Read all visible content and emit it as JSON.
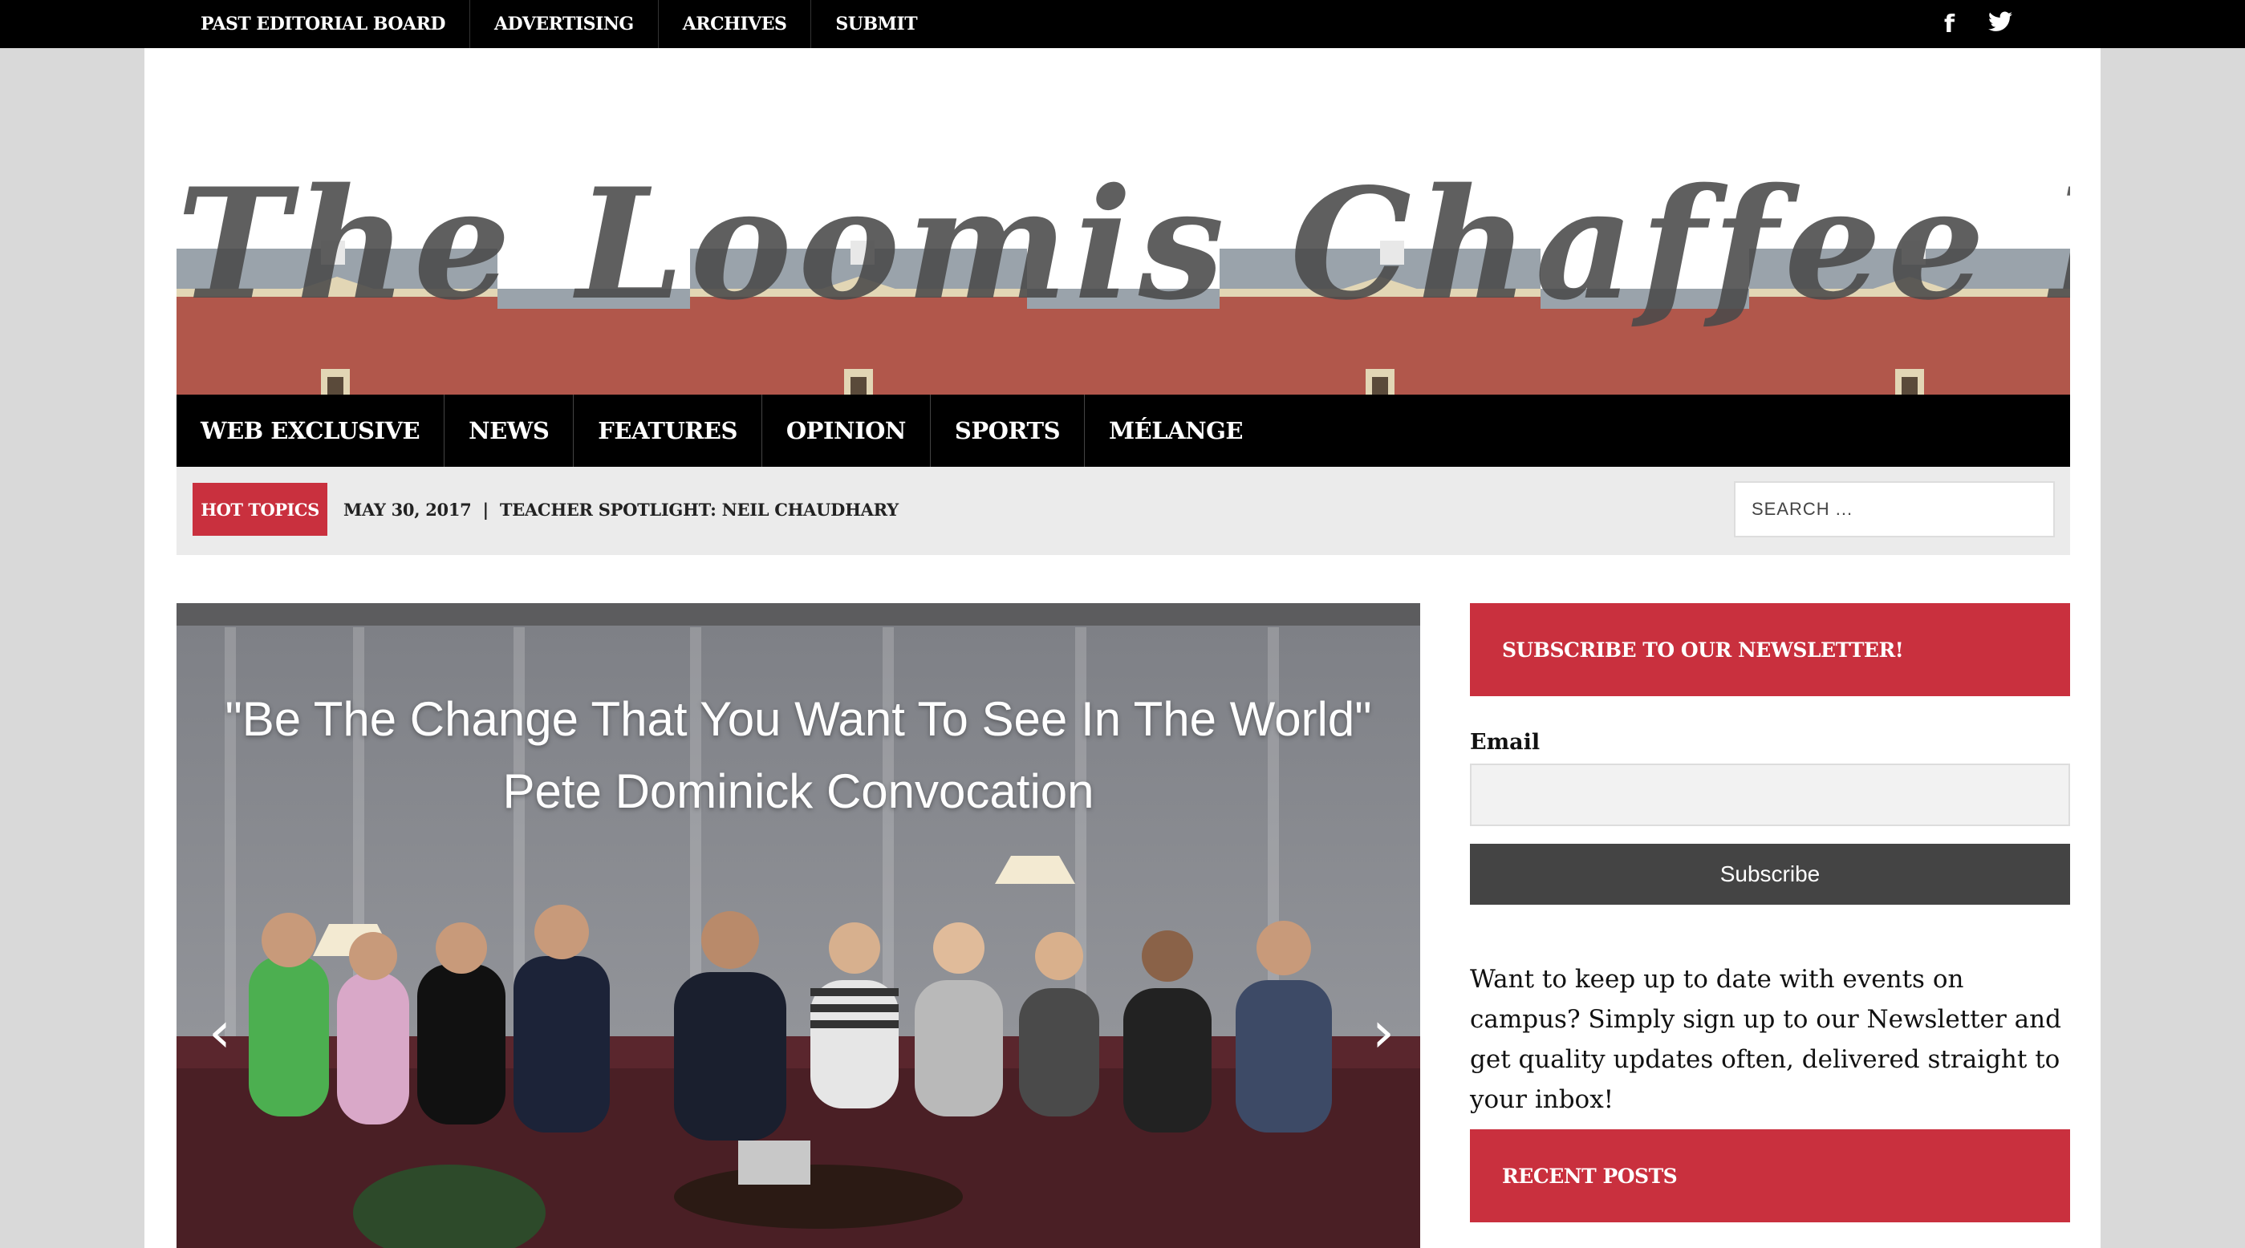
{
  "top_nav": {
    "items": [
      "PAST EDITORIAL BOARD",
      "ADVERTISING",
      "ARCHIVES",
      "SUBMIT"
    ]
  },
  "social": {
    "facebook": "f",
    "twitter": "🐦"
  },
  "masthead": {
    "title": "The Loomis Chaffee Log"
  },
  "main_nav": {
    "items": [
      "WEB EXCLUSIVE",
      "NEWS",
      "FEATURES",
      "OPINION",
      "SPORTS",
      "MÉLANGE"
    ]
  },
  "hot_topics": {
    "label": "HOT TOPICS",
    "text": "MAY 30, 2017  |  TEACHER SPOTLIGHT: NEIL CHAUDHARY"
  },
  "search": {
    "placeholder": "SEARCH ..."
  },
  "slider": {
    "title": "\"Be The Change That You Want To See In The World\" Pete Dominick Convocation",
    "prev": "‹",
    "next": "›"
  },
  "sidebar": {
    "newsletter_heading": "SUBSCRIBE TO OUR NEWSLETTER!",
    "email_label": "Email",
    "subscribe_label": "Subscribe",
    "promo_text": "Want to keep up to date with events on campus? Simply sign up to our Newsletter and get quality updates often, delivered straight to your inbox!",
    "recent_posts_heading": "RECENT POSTS"
  },
  "colors": {
    "accent_red": "#c9303e",
    "nav_black": "#000000",
    "button_gray": "#444444"
  }
}
